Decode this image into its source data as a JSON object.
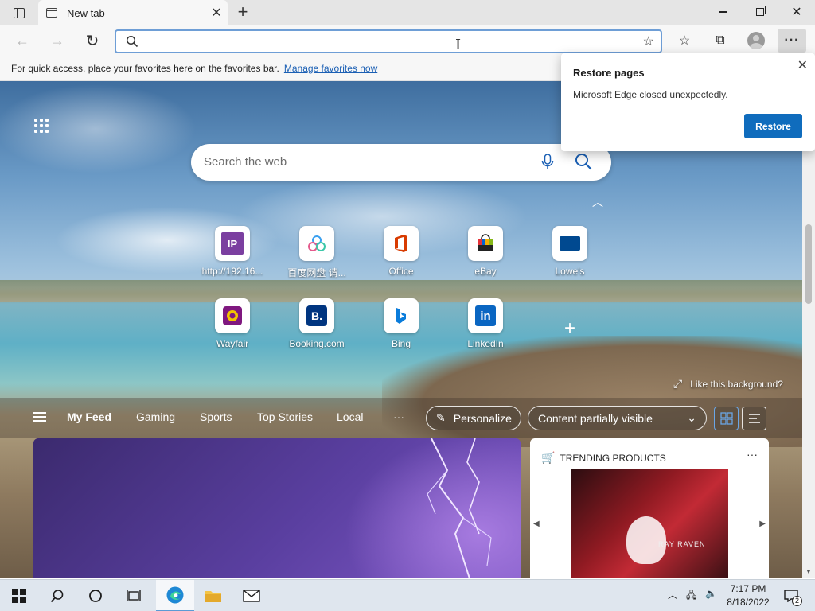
{
  "tab": {
    "title": "New tab"
  },
  "address": {
    "value": "",
    "placeholder": ""
  },
  "favorites_bar": {
    "message": "For quick access, place your favorites here on the favorites bar.",
    "link": "Manage favorites now"
  },
  "popup": {
    "title": "Restore pages",
    "message": "Microsoft Edge closed unexpectedly.",
    "button": "Restore"
  },
  "search": {
    "placeholder": "Search the web"
  },
  "quick_links": [
    {
      "label": "http://192.16...",
      "icon": "ip-icon"
    },
    {
      "label": "百度网盘 请...",
      "icon": "baidu-netdisk-icon"
    },
    {
      "label": "Office",
      "icon": "office-icon"
    },
    {
      "label": "eBay",
      "icon": "ebay-icon"
    },
    {
      "label": "Lowe's",
      "icon": "lowes-icon"
    },
    {
      "label": "Wayfair",
      "icon": "wayfair-icon"
    },
    {
      "label": "Booking.com",
      "icon": "booking-icon"
    },
    {
      "label": "Bing",
      "icon": "bing-icon"
    },
    {
      "label": "LinkedIn",
      "icon": "linkedin-icon"
    }
  ],
  "like_background": "Like this background?",
  "feed": {
    "tabs": [
      "My Feed",
      "Gaming",
      "Sports",
      "Top Stories",
      "Local"
    ],
    "more": "···",
    "personalize": "Personalize",
    "content_visibility": "Content partially visible"
  },
  "trending": {
    "title": "TRENDING PRODUCTS",
    "more": "···"
  },
  "product_text": "RAY RAVEN",
  "taskbar": {
    "time": "7:17 PM",
    "date": "8/18/2022",
    "notifications": "2"
  },
  "colors": {
    "accent": "#0f6cbd",
    "ntp_sky": "#4f7fb0",
    "taskbar": "#dfe6ee"
  }
}
